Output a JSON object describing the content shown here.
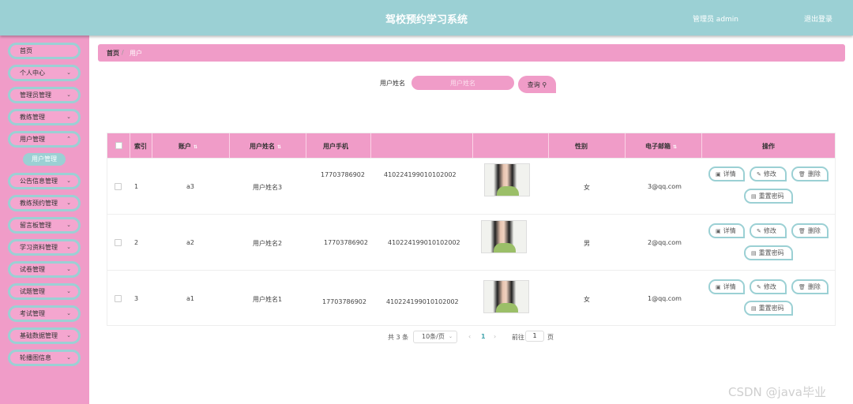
{
  "header": {
    "title": "驾校预约学习系统",
    "user": "管理员 admin",
    "logout": "退出登录"
  },
  "sidebar": {
    "items": [
      {
        "label": "首页",
        "chevron": false
      },
      {
        "label": "个人中心",
        "chevron": true
      },
      {
        "label": "管理员管理",
        "chevron": true
      },
      {
        "label": "教练管理",
        "chevron": true
      },
      {
        "label": "用户管理",
        "chevron": true
      },
      {
        "label": "公告信息管理",
        "chevron": true
      },
      {
        "label": "教练预约管理",
        "chevron": true
      },
      {
        "label": "留言板管理",
        "chevron": true
      },
      {
        "label": "学习资料管理",
        "chevron": true
      },
      {
        "label": "试卷管理",
        "chevron": true
      },
      {
        "label": "试题管理",
        "chevron": true
      },
      {
        "label": "考试管理",
        "chevron": true
      },
      {
        "label": "基础数据管理",
        "chevron": true
      },
      {
        "label": "轮播图信息",
        "chevron": true
      }
    ],
    "active_sub": "用户管理"
  },
  "breadcrumb": {
    "home": "首页",
    "current": "用户"
  },
  "search": {
    "label": "用户姓名",
    "placeholder": "用户姓名",
    "button": "查询"
  },
  "table": {
    "headers": {
      "index": "索引",
      "account": "账户",
      "name": "用户姓名",
      "phone": "用户手机",
      "gender": "性别",
      "email": "电子邮箱",
      "actions": "操作"
    },
    "rows": [
      {
        "index": "1",
        "account": "a3",
        "name": "用户姓名3",
        "phone": "17703786902",
        "idcard": "410224199010102002",
        "gender": "女",
        "email": "3@qq.com"
      },
      {
        "index": "2",
        "account": "a2",
        "name": "用户姓名2",
        "phone": "17703786902",
        "idcard": "410224199010102002",
        "gender": "男",
        "email": "2@qq.com"
      },
      {
        "index": "3",
        "account": "a1",
        "name": "用户姓名1",
        "phone": "17703786902",
        "idcard": "410224199010102002",
        "gender": "女",
        "email": "1@qq.com"
      }
    ],
    "actions": {
      "detail": "详情",
      "edit": "修改",
      "delete": "删除",
      "reset": "重置密码"
    }
  },
  "pagination": {
    "total": "共 3 条",
    "page_size": "10条/页",
    "current": "1",
    "goto_label": "前往",
    "goto_value": "1",
    "page_unit": "页"
  },
  "watermark": "CSDN @java毕业"
}
